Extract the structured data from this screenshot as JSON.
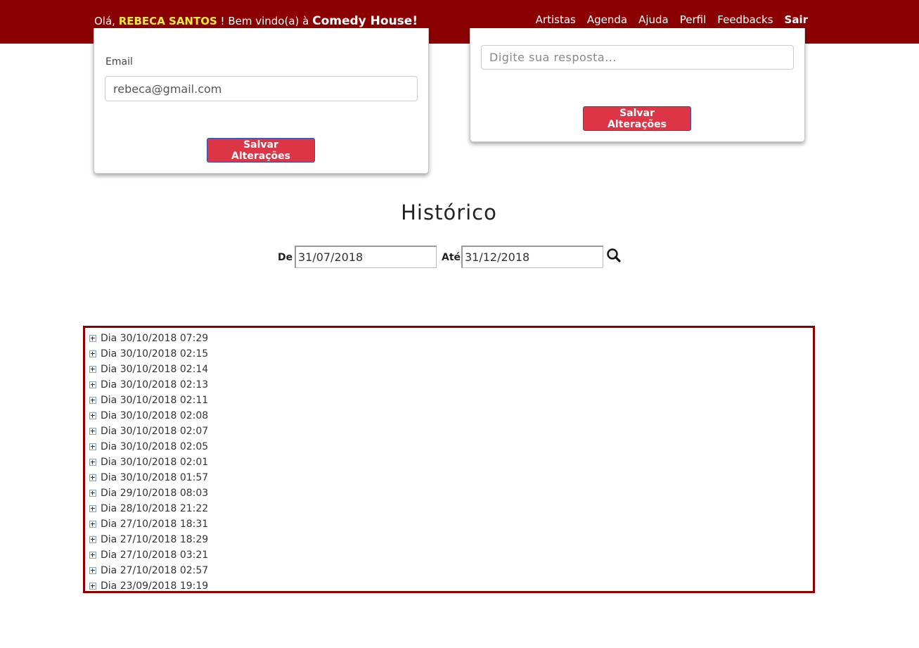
{
  "header": {
    "greeting_prefix": "Olá, ",
    "user_name": "REBECA SANTOS",
    "greeting_middle": " ! Bem vindo(a) à ",
    "brand": "Comedy House!",
    "nav": [
      {
        "label": "Artistas"
      },
      {
        "label": "Agenda"
      },
      {
        "label": "Ajuda"
      },
      {
        "label": "Perfil"
      },
      {
        "label": "Feedbacks"
      },
      {
        "label": "Sair"
      }
    ],
    "active_nav": "Perfil"
  },
  "profile_card": {
    "email_label": "Email",
    "email_value": "rebeca@gmail.com",
    "save_label": "Salvar Alterações"
  },
  "answer_card": {
    "answer_placeholder": "Digite sua resposta...",
    "save_label": "Salvar Alterações"
  },
  "history": {
    "title": "Histórico",
    "from_label": "De",
    "from_value": "31/07/2018",
    "to_label": "Até",
    "to_value": "31/12/2018",
    "items": [
      {
        "label": "Dia 30/10/2018 07:29"
      },
      {
        "label": "Dia 30/10/2018 02:15"
      },
      {
        "label": "Dia 30/10/2018 02:14"
      },
      {
        "label": "Dia 30/10/2018 02:13"
      },
      {
        "label": "Dia 30/10/2018 02:11"
      },
      {
        "label": "Dia 30/10/2018 02:08"
      },
      {
        "label": "Dia 30/10/2018 02:07"
      },
      {
        "label": "Dia 30/10/2018 02:05"
      },
      {
        "label": "Dia 30/10/2018 02:01"
      },
      {
        "label": "Dia 30/10/2018 01:57"
      },
      {
        "label": "Dia 29/10/2018 08:03"
      },
      {
        "label": "Dia 28/10/2018 21:22"
      },
      {
        "label": "Dia 27/10/2018 18:31"
      },
      {
        "label": "Dia 27/10/2018 18:29"
      },
      {
        "label": "Dia 27/10/2018 03:21"
      },
      {
        "label": "Dia 27/10/2018 02:57"
      },
      {
        "label": "Dia 23/09/2018 19:19"
      }
    ]
  },
  "colors": {
    "navbar": "#8b0000",
    "username": "#ffeb3b",
    "button": "#dc3545",
    "history_border": "#8b0000"
  }
}
